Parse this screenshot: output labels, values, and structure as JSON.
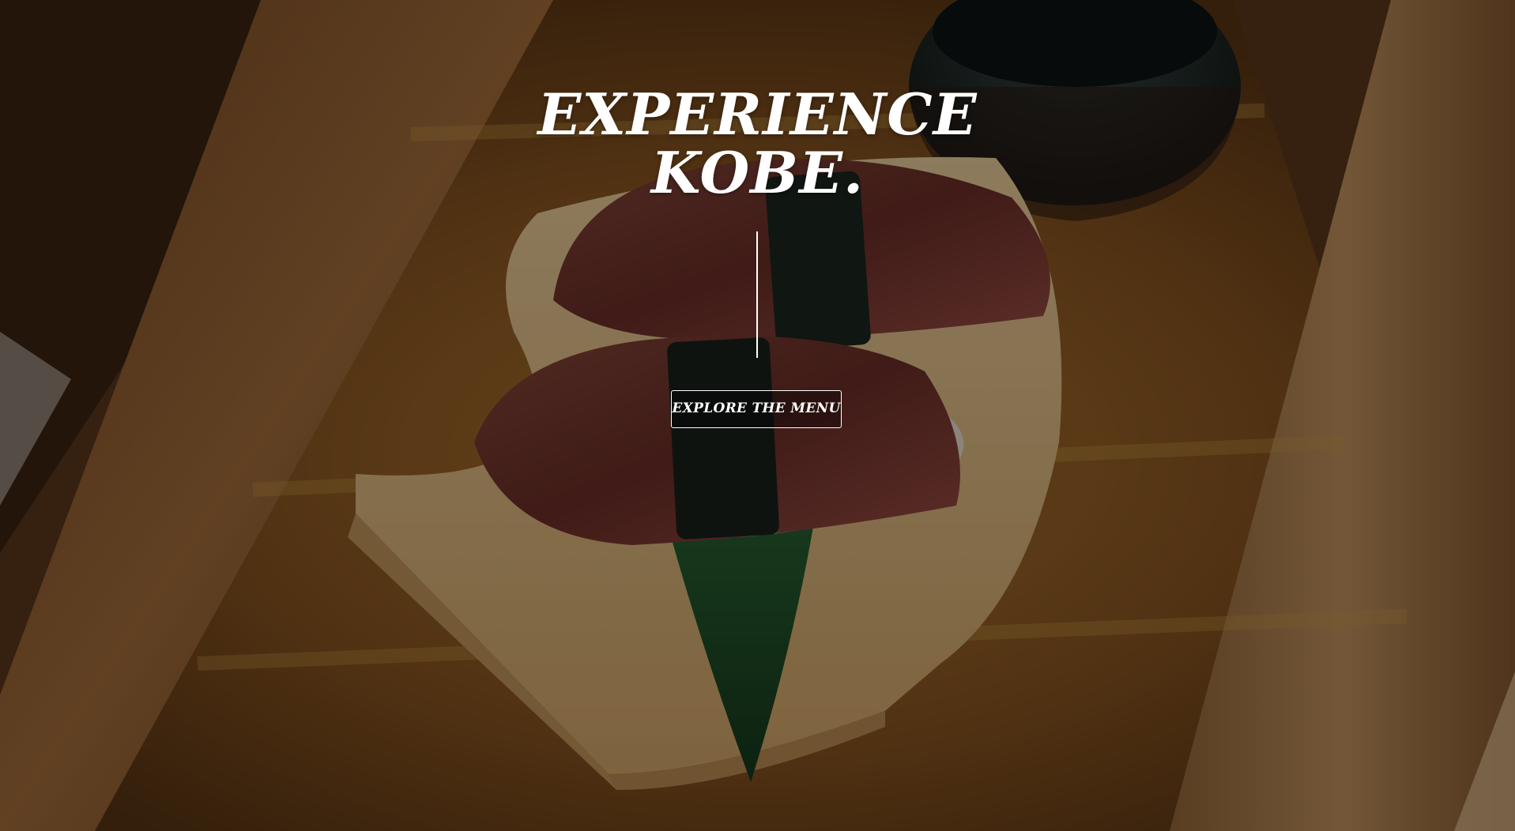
{
  "hero": {
    "headline_line1": "EXPERIENCE",
    "headline_line2": "KOBE.",
    "cta_label": "EXPLORE THE MENU"
  },
  "colors": {
    "text": "#ffffff",
    "overlay": "rgba(0,0,0,0.42)",
    "wood": "#c48a4e",
    "counter": "#8a5a2a",
    "leaf": "#1f4a26"
  },
  "background": {
    "subject": "wagyu beef nigiri sushi on a wooden geta plate with bamboo leaf and sake cup"
  }
}
